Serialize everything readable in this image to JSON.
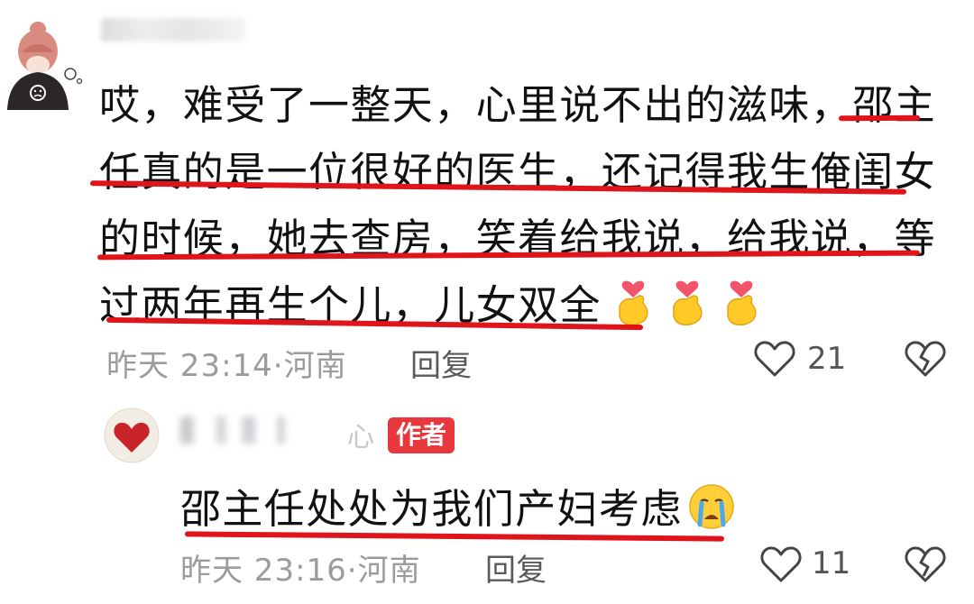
{
  "comment": {
    "avatar_icon": "girl-avatar-icon",
    "lines": [
      "哎，难受了一整天，心里说不出的滋味，邵主",
      "任真的是一位很好的医生，还记得我生俺闺女",
      "的时候，她去查房，笑着给我说，给我说，等",
      "过两年再生个儿，儿女双全"
    ],
    "emoji": [
      "finger-heart-emoji",
      "finger-heart-emoji",
      "finger-heart-emoji"
    ],
    "time": "昨天 23:14",
    "separator": "·",
    "location": "河南",
    "reply_label": "回复",
    "likes": "21"
  },
  "reply": {
    "avatar_icon": "heart-avatar-icon",
    "name_tail": "心",
    "badge": "作者",
    "text": "邵主任处处为我们产妇考虑",
    "emoji": "crying-face-emoji",
    "time": "昨天 23:16",
    "separator": "·",
    "location": "河南",
    "reply_label": "回复",
    "likes": "11"
  },
  "colors": {
    "underline": "#e0151b",
    "badge": "#e8383d",
    "meta_text": "#9b9b9b"
  }
}
